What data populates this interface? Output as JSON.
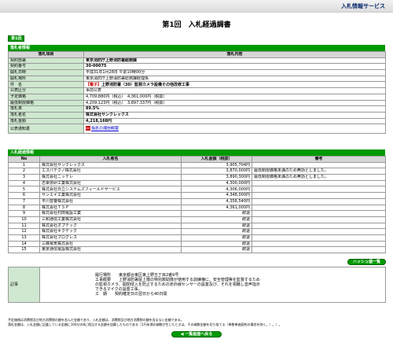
{
  "header": {
    "service_name": "入札情報サービス"
  },
  "title": "第1回　入札経過調書",
  "round_tab": "第1回",
  "award": {
    "section_title": "落札者情報",
    "col_item": "落札項目",
    "col_content": "落札内容",
    "rows": [
      {
        "label": "契約部署",
        "value": "東京消防庁上野消防署総務課"
      },
      {
        "label": "契約番号",
        "value": "30-00075"
      },
      {
        "label": "開札日時",
        "value": "平成31年1月28日 午前10時00分"
      },
      {
        "label": "開札場所",
        "value": "東京消防庁上野消防署総務課経理係"
      },
      {
        "label": "件　名",
        "prefix": "【電子】",
        "value": "上野消防署（30）監視カメラ設備その他改修工事"
      },
      {
        "label": "公表区分",
        "value": "事前公表"
      },
      {
        "label": "予定価格",
        "value": "4,709,880円（税込）　4,361,000円（税抜）"
      },
      {
        "label": "最低制限価格",
        "value": "4,209,123円（税込）　3,897,337円（税抜）"
      },
      {
        "label": "落札率",
        "value": "89.5%"
      },
      {
        "label": "落札者名",
        "value": "株式会社サンクレックス"
      },
      {
        "label": "落札金額",
        "value": "4,218,168円"
      },
      {
        "label": "公表通知書",
        "link": "指名の理由概要"
      }
    ]
  },
  "bids": {
    "section_title": "入札経過情報",
    "col_no": "No",
    "col_name": "入札者名",
    "col_amount": "入札金額（税抜）",
    "col_note": "備考",
    "rows": [
      {
        "no": "1",
        "name": "株式会社サンクレックス",
        "amount": "3,905,704円",
        "note": ""
      },
      {
        "no": "2",
        "name": "エスバテクノ株式会社",
        "amount": "3,870,000円",
        "note": "最低制限価格未満のため無効としました。"
      },
      {
        "no": "3",
        "name": "株式会社ニッテレ",
        "amount": "3,890,300円",
        "note": "最低制限価格未満のため無効としました。"
      },
      {
        "no": "4",
        "name": "志幸技研工業株式会社",
        "amount": "4,300,000円",
        "note": ""
      },
      {
        "no": "5",
        "name": "株式会社日立システムズフィールドサービス",
        "amount": "4,306,000円",
        "note": ""
      },
      {
        "no": "6",
        "name": "サンエイ工業株式会社",
        "amount": "4,348,000円",
        "note": ""
      },
      {
        "no": "7",
        "name": "平川音響株式会社",
        "amount": "4,358,540円",
        "note": ""
      },
      {
        "no": "8",
        "name": "株式会社ＴＳＰ",
        "amount": "4,361,000円",
        "note": ""
      },
      {
        "no": "9",
        "name": "株式会社村田電設工業",
        "amount": "辞退",
        "note": ""
      },
      {
        "no": "10",
        "name": "三和通信工業株式会社",
        "amount": "辞退",
        "note": ""
      },
      {
        "no": "11",
        "name": "株式会社オプテック",
        "amount": "辞退",
        "note": ""
      },
      {
        "no": "12",
        "name": "株式会社キクテック",
        "amount": "辞退",
        "note": ""
      },
      {
        "no": "13",
        "name": "株式会社プログレス",
        "amount": "辞退",
        "note": ""
      },
      {
        "no": "14",
        "name": "三峰電気株式会社",
        "amount": "辞退",
        "note": ""
      },
      {
        "no": "15",
        "name": "東京通信電設株式会社",
        "amount": "辞退",
        "note": ""
      }
    ]
  },
  "hash_button": "ハッシュ値一覧",
  "remarks": {
    "label": "記事",
    "lines": [
      "履行場所　　東京都台東区東上野五丁目2番9号",
      "工事概要　　上野消防署屋上階の特別救助隊が使用する訓練棟に、安全管理等を監督するため",
      "の監視カメラ、開閉侵入を防止するための赤外線センサーの設置及び、それを視聴し音声指示",
      "できるマイクの設置工事。",
      "工　期　　契約確定日の翌日から40日間"
    ]
  },
  "notes": [
    "予定価格は消費税及び地方消費税の額を含んだ金額であり、入札金額は、消費税及び地方消費税の額を含まない金額である。",
    "落札金額は、入札金額に記載している金額に100分の8に相当する金額を加算したものである（1円未満の端数が生じたときは、その端数金額を切り捨てる（単数単価契約の場合を除く。）。）。"
  ],
  "back_button": "◀ 一覧画面へ戻る"
}
